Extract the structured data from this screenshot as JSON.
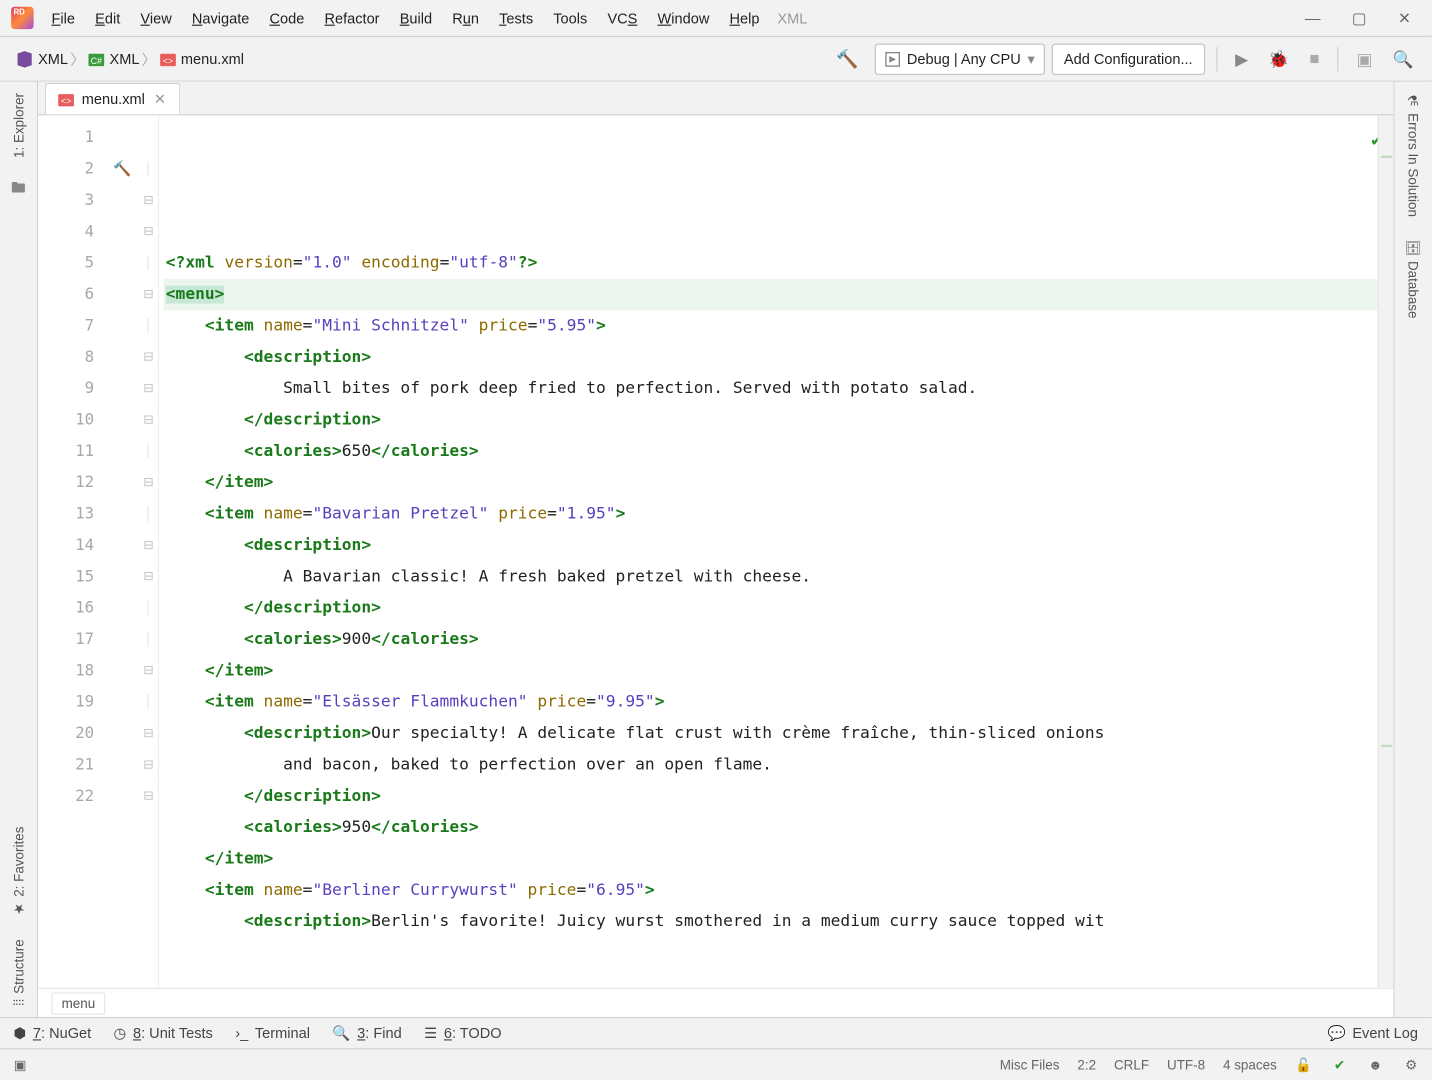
{
  "menu": {
    "items": [
      {
        "label": "File",
        "u": "F"
      },
      {
        "label": "Edit",
        "u": "E"
      },
      {
        "label": "View",
        "u": "V"
      },
      {
        "label": "Navigate",
        "u": "N"
      },
      {
        "label": "Code",
        "u": "C"
      },
      {
        "label": "Refactor",
        "u": "R"
      },
      {
        "label": "Build",
        "u": "B"
      },
      {
        "label": "Run",
        "u": "u"
      },
      {
        "label": "Tests",
        "u": "T"
      },
      {
        "label": "Tools",
        "u": ""
      },
      {
        "label": "VCS",
        "u": "S"
      },
      {
        "label": "Window",
        "u": "W"
      },
      {
        "label": "Help",
        "u": "H"
      }
    ],
    "dim": "XML"
  },
  "breadcrumbs": [
    {
      "icon": "sln",
      "label": "XML"
    },
    {
      "icon": "cs",
      "label": "XML"
    },
    {
      "icon": "xml",
      "label": "menu.xml"
    }
  ],
  "toolbar": {
    "config_label": "Debug | Any CPU",
    "add_config": "Add Configuration..."
  },
  "left_rail": {
    "explorer": "1: Explorer",
    "favorites": "2: Favorites",
    "structure": "Structure"
  },
  "right_rail": {
    "errors": "Errors In Solution",
    "database": "Database"
  },
  "tab": {
    "name": "menu.xml"
  },
  "code_lines": [
    {
      "n": 1,
      "html": "<span class='t-pi'>&lt;?</span><span class='t-tag'>xml</span> <span class='t-attr'>version</span><span class='t-eq'>=</span><span class='t-str'>\"1.0\"</span> <span class='t-attr'>encoding</span><span class='t-eq'>=</span><span class='t-str'>\"utf-8\"</span><span class='t-pi'>?&gt;</span>"
    },
    {
      "n": 2,
      "html": "<span class='sel'><span class='t-brack'>&lt;</span><span class='t-tag'>menu</span><span class='t-brack'>&gt;</span></span>",
      "hl": true,
      "hammer": true
    },
    {
      "n": 3,
      "html": "    <span class='t-brack'>&lt;</span><span class='t-tag'>item</span> <span class='t-attr'>name</span><span class='t-eq'>=</span><span class='t-str'>\"Mini Schnitzel\"</span> <span class='t-attr'>price</span><span class='t-eq'>=</span><span class='t-str'>\"5.95\"</span><span class='t-brack'>&gt;</span>",
      "fold": true
    },
    {
      "n": 4,
      "html": "        <span class='t-brack'>&lt;</span><span class='t-tag'>description</span><span class='t-brack'>&gt;</span>",
      "fold": true
    },
    {
      "n": 5,
      "html": "            Small bites of pork deep fried to perfection. Served with potato salad."
    },
    {
      "n": 6,
      "html": "        <span class='t-brack'>&lt;/</span><span class='t-tag'>description</span><span class='t-brack'>&gt;</span>",
      "folde": true
    },
    {
      "n": 7,
      "html": "        <span class='t-brack'>&lt;</span><span class='t-tag'>calories</span><span class='t-brack'>&gt;</span>650<span class='t-brack'>&lt;/</span><span class='t-tag'>calories</span><span class='t-brack'>&gt;</span>"
    },
    {
      "n": 8,
      "html": "    <span class='t-brack'>&lt;/</span><span class='t-tag'>item</span><span class='t-brack'>&gt;</span>",
      "folde": true
    },
    {
      "n": 9,
      "html": "    <span class='t-brack'>&lt;</span><span class='t-tag'>item</span> <span class='t-attr'>name</span><span class='t-eq'>=</span><span class='t-str'>\"Bavarian Pretzel\"</span> <span class='t-attr'>price</span><span class='t-eq'>=</span><span class='t-str'>\"1.95\"</span><span class='t-brack'>&gt;</span>",
      "fold": true
    },
    {
      "n": 10,
      "html": "        <span class='t-brack'>&lt;</span><span class='t-tag'>description</span><span class='t-brack'>&gt;</span>",
      "fold": true
    },
    {
      "n": 11,
      "html": "            A Bavarian classic! A fresh baked pretzel with cheese."
    },
    {
      "n": 12,
      "html": "        <span class='t-brack'>&lt;/</span><span class='t-tag'>description</span><span class='t-brack'>&gt;</span>",
      "folde": true
    },
    {
      "n": 13,
      "html": "        <span class='t-brack'>&lt;</span><span class='t-tag'>calories</span><span class='t-brack'>&gt;</span>900<span class='t-brack'>&lt;/</span><span class='t-tag'>calories</span><span class='t-brack'>&gt;</span>"
    },
    {
      "n": 14,
      "html": "    <span class='t-brack'>&lt;/</span><span class='t-tag'>item</span><span class='t-brack'>&gt;</span>",
      "folde": true
    },
    {
      "n": 15,
      "html": "    <span class='t-brack'>&lt;</span><span class='t-tag'>item</span> <span class='t-attr'>name</span><span class='t-eq'>=</span><span class='t-str'>\"Elsässer Flammkuchen\"</span> <span class='t-attr'>price</span><span class='t-eq'>=</span><span class='t-str'>\"9.95\"</span><span class='t-brack'>&gt;</span>",
      "fold": true
    },
    {
      "n": 16,
      "html": "        <span class='t-brack'>&lt;</span><span class='t-tag'>description</span><span class='t-brack'>&gt;</span>Our specialty! A delicate flat crust with crème fraîche, thin-sliced onions"
    },
    {
      "n": 17,
      "html": "            and bacon, baked to perfection over an open flame."
    },
    {
      "n": 18,
      "html": "        <span class='t-brack'>&lt;/</span><span class='t-tag'>description</span><span class='t-brack'>&gt;</span>",
      "folde": true
    },
    {
      "n": 19,
      "html": "        <span class='t-brack'>&lt;</span><span class='t-tag'>calories</span><span class='t-brack'>&gt;</span>950<span class='t-brack'>&lt;/</span><span class='t-tag'>calories</span><span class='t-brack'>&gt;</span>"
    },
    {
      "n": 20,
      "html": "    <span class='t-brack'>&lt;/</span><span class='t-tag'>item</span><span class='t-brack'>&gt;</span>",
      "folde": true
    },
    {
      "n": 21,
      "html": "    <span class='t-brack'>&lt;</span><span class='t-tag'>item</span> <span class='t-attr'>name</span><span class='t-eq'>=</span><span class='t-str'>\"Berliner Currywurst\"</span> <span class='t-attr'>price</span><span class='t-eq'>=</span><span class='t-str'>\"6.95\"</span><span class='t-brack'>&gt;</span>",
      "fold": true
    },
    {
      "n": 22,
      "html": "        <span class='t-brack'>&lt;</span><span class='t-tag'>description</span><span class='t-brack'>&gt;</span>Berlin's favorite! Juicy wurst smothered in a medium curry sauce topped wit",
      "fold": true
    }
  ],
  "code_breadcrumb": "menu",
  "tool_windows": {
    "nuget": "7: NuGet",
    "unit": "8: Unit Tests",
    "terminal": "Terminal",
    "find": "3: Find",
    "todo": "6: TODO",
    "eventlog": "Event Log"
  },
  "status": {
    "misc": "Misc Files",
    "pos": "2:2",
    "lineend": "CRLF",
    "encoding": "UTF-8",
    "indent": "4 spaces"
  }
}
